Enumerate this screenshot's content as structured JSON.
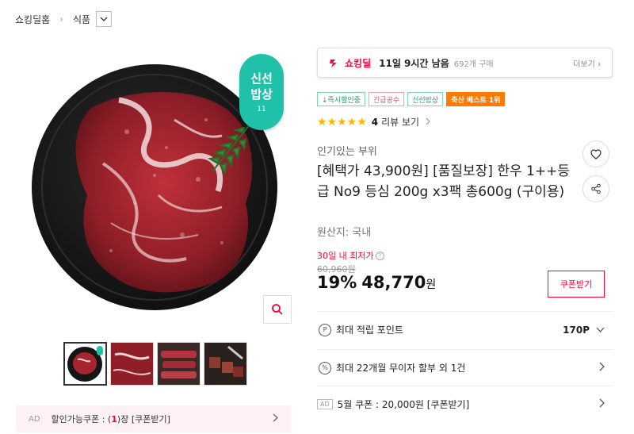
{
  "breadcrumb": {
    "home": "쇼킹딜홈",
    "category": "식품"
  },
  "badge": {
    "line1": "신선",
    "line2": "밥상",
    "num": "11"
  },
  "coupon_bar": {
    "ad": "AD",
    "text_before": "할인가능쿠폰 : (",
    "count": "1",
    "text_after": ")장 [쿠폰받기]"
  },
  "deal": {
    "logo": "쇼킹딜",
    "remain": "11일 9시간 남음",
    "buy": "692개 구매",
    "more": "더보기 ›"
  },
  "tags": [
    "↓즉시할인중",
    "긴급공수",
    "신선밥상",
    "축산 베스트 1위"
  ],
  "rating": {
    "stars": "★★★★★",
    "count": "4",
    "label": "리뷰 보기"
  },
  "product": {
    "category": "인기있는 부위",
    "title": "[혜택가 43,900원] [품질보장] 한우 1++등급 No9 등심 200g x3팩 총600g (구이용)",
    "origin": "원산지:  국내",
    "lowest_label": "30일 내 최저가",
    "original_price": "60,960원",
    "discount_rate": "19%",
    "price": "48,770",
    "won": "원"
  },
  "coupon_button": "쿠폰받기",
  "rows": {
    "points_label": "최대 적립 포인트",
    "points_value": "170P",
    "installment": "최대 22개월 무이자 할부 외 1건",
    "coupon_ad": "AD",
    "coupon_text": "5월 쿠폰 : 20,000원 [쿠폰받기]"
  },
  "colors": {
    "accent": "#ff0038",
    "star": "#ffb400",
    "badge": "#21c1a9"
  }
}
